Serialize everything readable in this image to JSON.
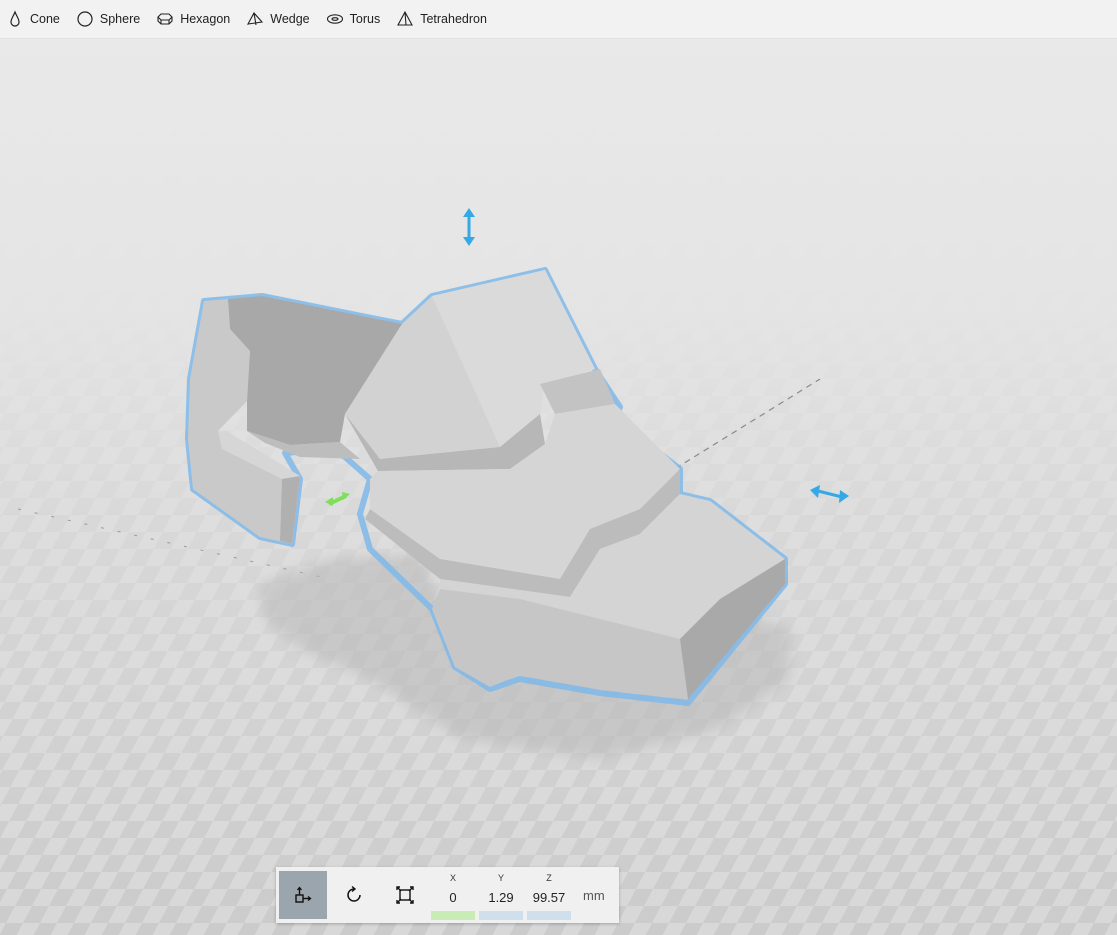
{
  "toolbar": {
    "shapes": [
      {
        "label": "Cone",
        "icon": "cone-icon"
      },
      {
        "label": "Sphere",
        "icon": "sphere-icon"
      },
      {
        "label": "Hexagon",
        "icon": "hexagon-icon"
      },
      {
        "label": "Wedge",
        "icon": "wedge-icon"
      },
      {
        "label": "Torus",
        "icon": "torus-icon"
      },
      {
        "label": "Tetrahedron",
        "icon": "tetrahedron-icon"
      }
    ]
  },
  "transform": {
    "tools": [
      {
        "name": "move-tool",
        "icon": "move-icon",
        "active": true
      },
      {
        "name": "rotate-tool",
        "icon": "rotate-icon",
        "active": false
      },
      {
        "name": "scale-tool",
        "icon": "scale-icon",
        "active": false
      }
    ],
    "x_label": "X",
    "x_value": "0",
    "y_label": "Y",
    "y_value": "1.29",
    "z_label": "Z",
    "z_value": "99.57",
    "unit": "mm"
  },
  "colors": {
    "selection_outline": "#7fb9ea",
    "gizmo_blue": "#35a9e6",
    "gizmo_green": "#7ee05a",
    "model_gray": "#cfcfcf",
    "active_tool": "#9aa5ae"
  }
}
